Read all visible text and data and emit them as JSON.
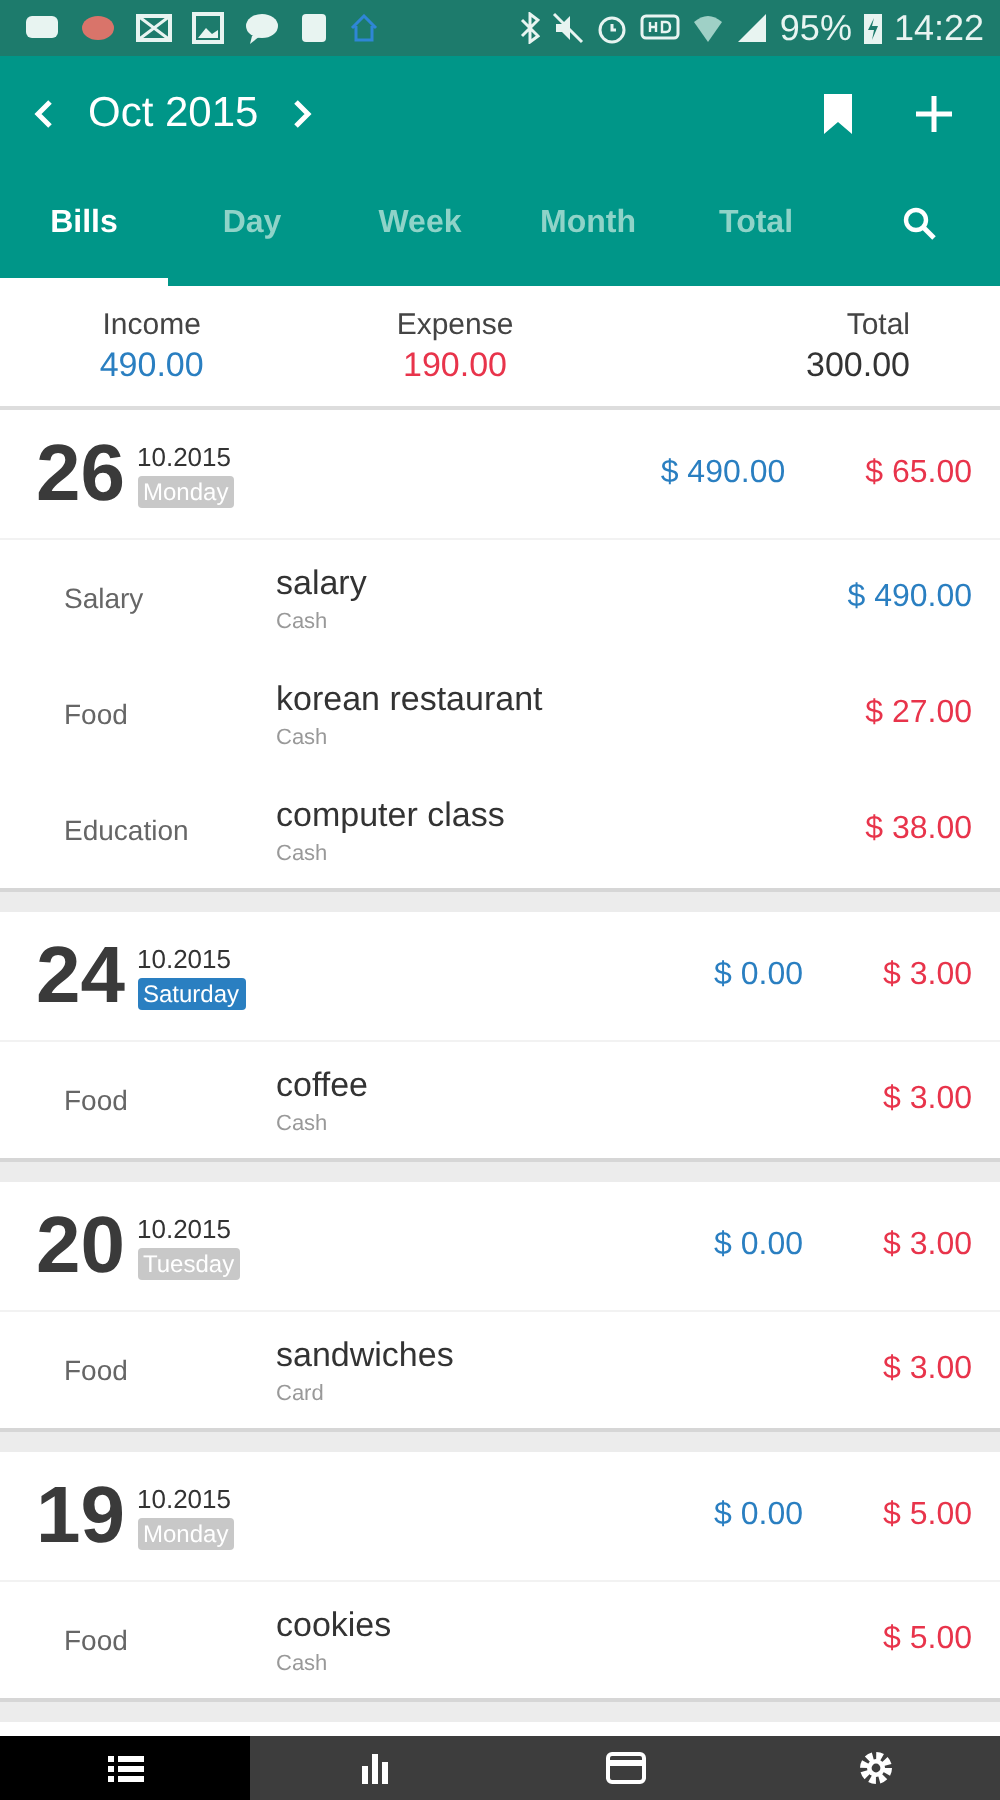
{
  "status_bar": {
    "battery": "95%",
    "time": "14:22"
  },
  "toolbar": {
    "title": "Oct 2015"
  },
  "tabs": [
    {
      "label": "Bills",
      "selected": true
    },
    {
      "label": "Day",
      "selected": false
    },
    {
      "label": "Week",
      "selected": false
    },
    {
      "label": "Month",
      "selected": false
    },
    {
      "label": "Total",
      "selected": false
    }
  ],
  "summary": [
    {
      "label": "Income",
      "value": "490.00",
      "kind": "income"
    },
    {
      "label": "Expense",
      "value": "190.00",
      "kind": "expense"
    },
    {
      "label": "Total",
      "value": "300.00",
      "kind": "total"
    }
  ],
  "days": [
    {
      "day": "26",
      "month": "10.2015",
      "weekday": "Monday",
      "highlighted": false,
      "income": "$ 490.00",
      "expense": "$ 65.00",
      "entries": [
        {
          "category": "Salary",
          "title": "salary",
          "account": "Cash",
          "amount": "$ 490.00",
          "kind": "income"
        },
        {
          "category": "Food",
          "title": "korean restaurant",
          "account": "Cash",
          "amount": "$ 27.00",
          "kind": "expense"
        },
        {
          "category": "Education",
          "title": "computer class",
          "account": "Cash",
          "amount": "$ 38.00",
          "kind": "expense"
        }
      ]
    },
    {
      "day": "24",
      "month": "10.2015",
      "weekday": "Saturday",
      "highlighted": true,
      "income": "$ 0.00",
      "expense": "$ 3.00",
      "entries": [
        {
          "category": "Food",
          "title": "coffee",
          "account": "Cash",
          "amount": "$ 3.00",
          "kind": "expense"
        }
      ]
    },
    {
      "day": "20",
      "month": "10.2015",
      "weekday": "Tuesday",
      "highlighted": false,
      "income": "$ 0.00",
      "expense": "$ 3.00",
      "entries": [
        {
          "category": "Food",
          "title": "sandwiches",
          "account": "Card",
          "amount": "$ 3.00",
          "kind": "expense"
        }
      ]
    },
    {
      "day": "19",
      "month": "10.2015",
      "weekday": "Monday",
      "highlighted": false,
      "income": "$ 0.00",
      "expense": "$ 5.00",
      "entries": [
        {
          "category": "Food",
          "title": "cookies",
          "account": "Cash",
          "amount": "$ 5.00",
          "kind": "expense"
        }
      ]
    }
  ],
  "bottom_nav": [
    {
      "kind": "list",
      "selected": true
    },
    {
      "kind": "chart",
      "selected": false
    },
    {
      "kind": "card",
      "selected": false
    },
    {
      "kind": "settings",
      "selected": false
    }
  ]
}
